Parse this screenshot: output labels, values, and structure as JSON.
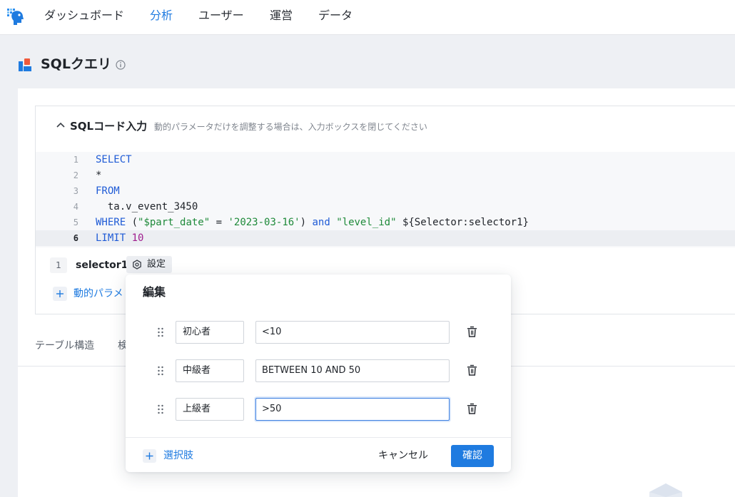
{
  "nav": {
    "items": [
      {
        "label": "ダッシュボード",
        "active": false
      },
      {
        "label": "分析",
        "active": true
      },
      {
        "label": "ユーザー",
        "active": false
      },
      {
        "label": "運営",
        "active": false
      },
      {
        "label": "データ",
        "active": false
      }
    ]
  },
  "page": {
    "title": "SQLクエリ"
  },
  "editor": {
    "title": "SQLコード入力",
    "hint": "動的パラメータだけを調整する場合は、入力ボックスを閉じてください",
    "lines": [
      {
        "no": "1",
        "text": "SELECT"
      },
      {
        "no": "2",
        "text": "*"
      },
      {
        "no": "3",
        "text": "FROM"
      },
      {
        "no": "4",
        "text": "  ta.v_event_3450"
      },
      {
        "no": "5",
        "text": "WHERE (\"$part_date\" = '2023-03-16') and \"level_id\" ${Selector:selector1}"
      },
      {
        "no": "6",
        "text": "LIMIT 10"
      }
    ]
  },
  "params": {
    "index": "1",
    "name": "selector1",
    "settings_label": "設定",
    "add_label": "動的パラメ"
  },
  "tabs": [
    {
      "label": "テーブル構造"
    },
    {
      "label": "検"
    }
  ],
  "modal": {
    "title": "編集",
    "options": [
      {
        "label": "初心者",
        "value": "<10"
      },
      {
        "label": "中級者",
        "value": "BETWEEN 10 AND 50"
      },
      {
        "label": "上級者",
        "value": ">50"
      }
    ],
    "add_option_label": "選択肢",
    "cancel_label": "キャンセル",
    "ok_label": "確認"
  },
  "colors": {
    "accent": "#1f7be0",
    "keyword": "#1f5bd6",
    "string": "#1f8a3a",
    "number": "#a0208f"
  }
}
